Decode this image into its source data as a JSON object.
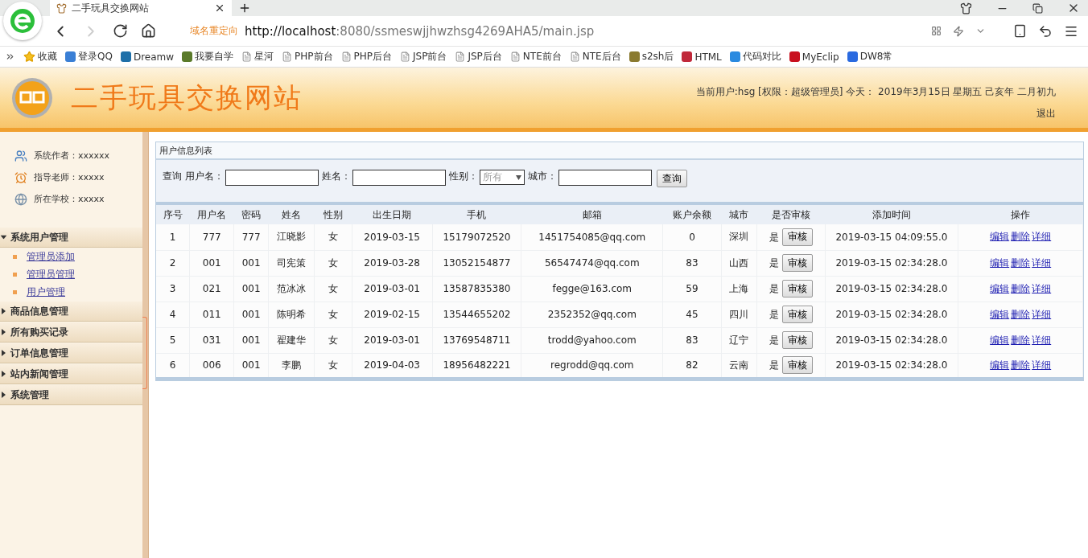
{
  "browser": {
    "tab_title": "二手玩具交换网站",
    "redirect_label": "域名重定向",
    "url_host": "http://localhost",
    "url_rest": ":8080/ssmeswjjhwzhsg4269AHA5/main.jsp",
    "bookmarks": [
      {
        "kind": "favorites",
        "label": "收藏"
      },
      {
        "kind": "site",
        "label": "登录QQ",
        "color": "#3a7fd5"
      },
      {
        "kind": "site",
        "label": "Dreamw",
        "color": "#1e6fa8"
      },
      {
        "kind": "site",
        "label": "我要自学",
        "color": "#5a7a2a"
      },
      {
        "kind": "page",
        "label": "星河"
      },
      {
        "kind": "page",
        "label": "PHP前台"
      },
      {
        "kind": "page",
        "label": "PHP后台"
      },
      {
        "kind": "page",
        "label": "JSP前台"
      },
      {
        "kind": "page",
        "label": "JSP后台"
      },
      {
        "kind": "page",
        "label": "NTE前台"
      },
      {
        "kind": "page",
        "label": "NTE后台"
      },
      {
        "kind": "site",
        "label": "s2sh后",
        "color": "#8a7a30"
      },
      {
        "kind": "site",
        "label": "HTML",
        "color": "#c0283a"
      },
      {
        "kind": "site",
        "label": "代码对比",
        "color": "#2a8ae0"
      },
      {
        "kind": "site",
        "label": "MyEclip",
        "color": "#c8101e"
      },
      {
        "kind": "site",
        "label": "DW8常",
        "color": "#2a6ae0"
      }
    ]
  },
  "header": {
    "site_title": "二手玩具交换网站",
    "user_info": "当前用户:hsg [权限：超级管理员] 今天： 2019年3月15日 星期五 己亥年 二月初九",
    "logout": "退出"
  },
  "sidebar": {
    "info": [
      {
        "kind": "author",
        "text": "系统作者：xxxxxx"
      },
      {
        "kind": "teacher",
        "text": "指导老师：xxxxx"
      },
      {
        "kind": "school",
        "text": "所在学校：xxxxx"
      }
    ],
    "menu": [
      {
        "label": "系统用户管理",
        "expanded": true,
        "children": [
          "管理员添加",
          "管理员管理",
          "用户管理"
        ]
      },
      {
        "label": "商品信息管理",
        "expanded": false
      },
      {
        "label": "所有购买记录",
        "expanded": false
      },
      {
        "label": "订单信息管理",
        "expanded": false
      },
      {
        "label": "站内新闻管理",
        "expanded": false
      },
      {
        "label": "系统管理",
        "expanded": false
      }
    ]
  },
  "panel": {
    "title": "用户信息列表",
    "search": {
      "prefix": "查询",
      "fields": [
        {
          "label": "用户名：",
          "kind": "text"
        },
        {
          "label": "姓名：",
          "kind": "text"
        },
        {
          "label": "性别：",
          "kind": "select",
          "value": "所有"
        },
        {
          "label": "城市：",
          "kind": "text"
        }
      ],
      "button": "查询"
    },
    "table": {
      "columns": [
        "序号",
        "用户名",
        "密码",
        "姓名",
        "性别",
        "出生日期",
        "手机",
        "邮箱",
        "账户余额",
        "城市",
        "是否审核",
        "添加时间",
        "操作"
      ],
      "rows": [
        {
          "cells": [
            "1",
            "777",
            "777",
            "江晓影",
            "女",
            "2019-03-15",
            "15179072520",
            "1451754085@qq.com",
            "0",
            "深圳"
          ],
          "approved": "是",
          "audit": "审核",
          "added": "2019-03-15 04:09:55.0",
          "actions": [
            "编辑",
            "删除",
            "详细"
          ]
        },
        {
          "cells": [
            "2",
            "001",
            "001",
            "司宪策",
            "女",
            "2019-03-28",
            "13052154877",
            "56547474@qq.com",
            "83",
            "山西"
          ],
          "approved": "是",
          "audit": "审核",
          "added": "2019-03-15 02:34:28.0",
          "actions": [
            "编辑",
            "删除",
            "详细"
          ]
        },
        {
          "cells": [
            "3",
            "021",
            "001",
            "范冰冰",
            "女",
            "2019-03-01",
            "13587835380",
            "fegge@163.com",
            "59",
            "上海"
          ],
          "approved": "是",
          "audit": "审核",
          "added": "2019-03-15 02:34:28.0",
          "actions": [
            "编辑",
            "删除",
            "详细"
          ]
        },
        {
          "cells": [
            "4",
            "011",
            "001",
            "陈明希",
            "女",
            "2019-02-15",
            "13544655202",
            "2352352@qq.com",
            "45",
            "四川"
          ],
          "approved": "是",
          "audit": "审核",
          "added": "2019-03-15 02:34:28.0",
          "actions": [
            "编辑",
            "删除",
            "详细"
          ]
        },
        {
          "cells": [
            "5",
            "031",
            "001",
            "翟建华",
            "女",
            "2019-03-01",
            "13769548711",
            "trodd@yahoo.com",
            "83",
            "辽宁"
          ],
          "approved": "是",
          "audit": "审核",
          "added": "2019-03-15 02:34:28.0",
          "actions": [
            "编辑",
            "删除",
            "详细"
          ]
        },
        {
          "cells": [
            "6",
            "006",
            "001",
            "李鹏",
            "女",
            "2019-04-03",
            "18956482221",
            "regrodd@qq.com",
            "82",
            "云南"
          ],
          "approved": "是",
          "audit": "审核",
          "added": "2019-03-15 02:34:28.0",
          "actions": [
            "编辑",
            "删除",
            "详细"
          ]
        }
      ]
    }
  }
}
